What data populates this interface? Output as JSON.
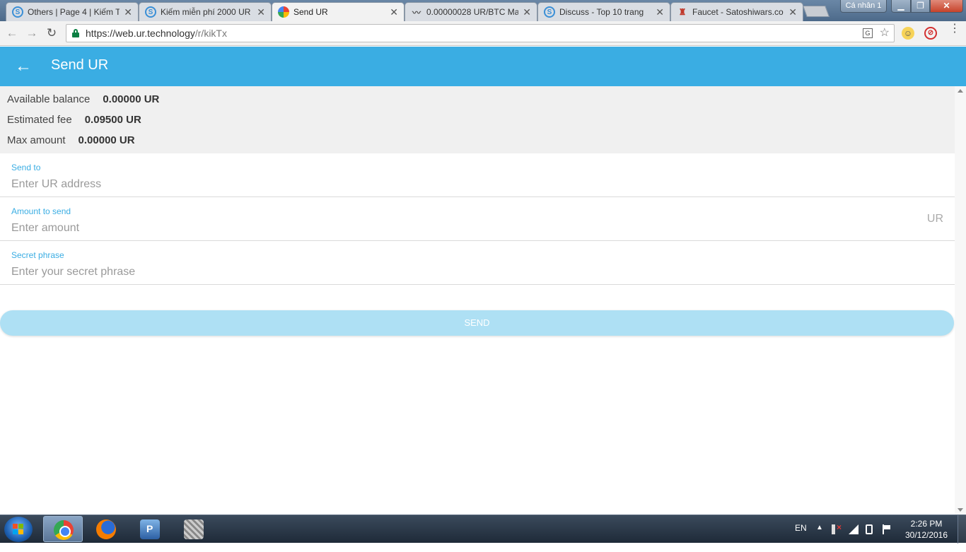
{
  "browser": {
    "tabs": [
      {
        "title": "Others | Page 4 | Kiếm T",
        "icon": "s-circle-icon"
      },
      {
        "title": "Kiếm miễn phí 2000 UR",
        "icon": "s-circle-icon"
      },
      {
        "title": "Send UR",
        "icon": "ur-logo-icon",
        "active": true
      },
      {
        "title": "0.00000028 UR/BTC Ma",
        "icon": "chart-icon"
      },
      {
        "title": "Discuss - Top 10 trang",
        "icon": "s-circle-icon"
      },
      {
        "title": "Faucet - Satoshiwars.co",
        "icon": "faucet-icon"
      }
    ],
    "profile_label": "Cá nhân 1",
    "window_buttons": {
      "minimize": "▁",
      "maximize": "❐",
      "close": "✕"
    },
    "nav": {
      "back": "←",
      "forward": "→",
      "reload": "↻"
    },
    "address": {
      "host": "https://web.ur.technology",
      "path": "/r/kikTx"
    },
    "omnibox_icons": {
      "translate": "G",
      "star": "☆"
    },
    "menu": "⋮"
  },
  "app": {
    "back_arrow": "←",
    "title": "Send UR",
    "accent_color": "#3aade3"
  },
  "info": {
    "available_label": "Available balance",
    "available_value": "0.00000 UR",
    "fee_label": "Estimated fee",
    "fee_value": "0.09500 UR",
    "max_label": "Max amount",
    "max_value": "0.00000 UR"
  },
  "form": {
    "send_to": {
      "label": "Send to",
      "placeholder": "Enter UR address",
      "value": ""
    },
    "amount": {
      "label": "Amount to send",
      "placeholder": "Enter amount",
      "value": "",
      "suffix": "UR"
    },
    "secret": {
      "label": "Secret phrase",
      "placeholder": "Enter your secret phrase",
      "value": ""
    },
    "send_button": "SEND"
  },
  "taskbar": {
    "apps": [
      "chrome-icon",
      "firefox-icon",
      "netsupport-icon",
      "network-icon"
    ],
    "language": "EN",
    "show_hidden": "▲",
    "time": "2:26 PM",
    "date": "30/12/2016"
  }
}
